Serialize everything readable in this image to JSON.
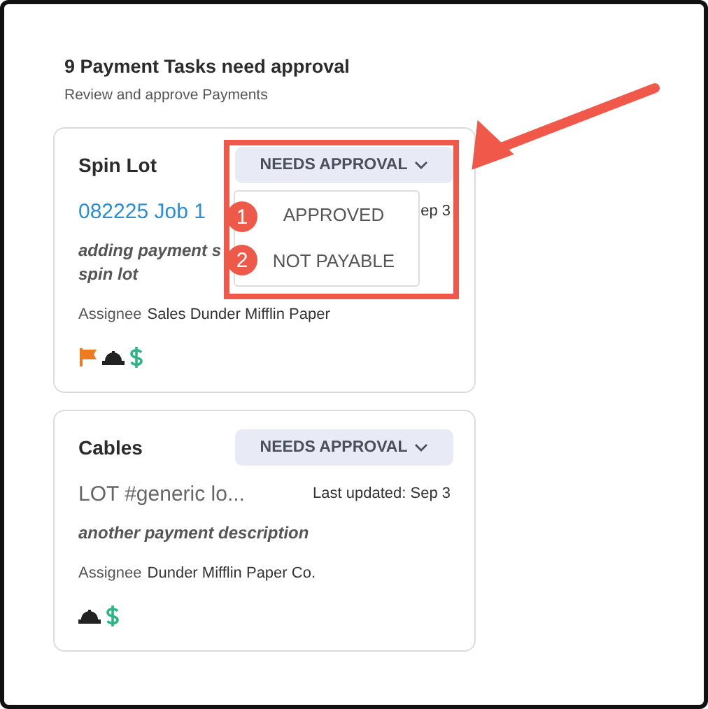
{
  "header": {
    "title": "9 Payment Tasks need approval",
    "subtitle": "Review and approve Payments"
  },
  "tasks": [
    {
      "title": "Spin Lot",
      "status": "NEEDS APPROVAL",
      "reference": {
        "text": "082225 Job 1",
        "kind": "link"
      },
      "updated": "ep 3",
      "description_lines": [
        "adding payment s",
        "spin lot"
      ],
      "assignee_label": "Assignee",
      "assignee": "Sales Dunder Mifflin Paper",
      "icons": [
        {
          "kind": "flag"
        },
        {
          "kind": "hardhat"
        },
        {
          "kind": "dollar"
        }
      ]
    },
    {
      "title": "Cables",
      "status": "NEEDS APPROVAL",
      "reference": {
        "text": "LOT #generic lo...",
        "kind": "plain"
      },
      "updated": "Last updated: Sep 3",
      "description_lines": [
        "another payment description"
      ],
      "assignee_label": "Assignee",
      "assignee": "Dunder Mifflin Paper Co.",
      "icons": [
        {
          "kind": "hardhat"
        },
        {
          "kind": "dollar"
        }
      ]
    }
  ],
  "dropdown": {
    "options": [
      {
        "label": "APPROVED",
        "marker": "1"
      },
      {
        "label": "NOT PAYABLE",
        "marker": "2"
      }
    ]
  }
}
